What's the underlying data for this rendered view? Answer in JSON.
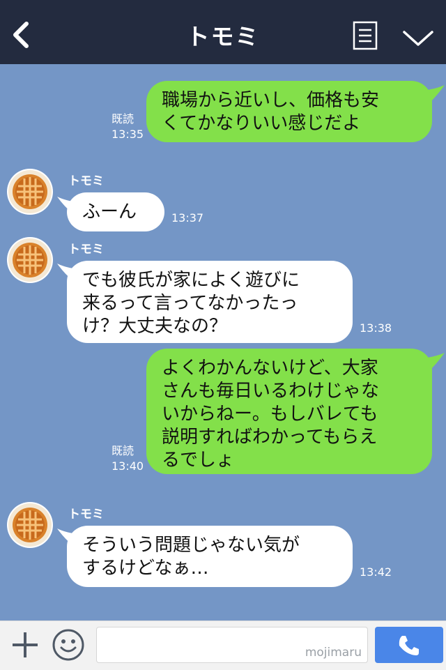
{
  "header": {
    "title": "トモミ",
    "icons": [
      "back-chevron",
      "note-list",
      "chevron-down"
    ]
  },
  "messages": [
    {
      "side": "me",
      "text": "職場から近いし、価格も安くてかなりいい感じだよ",
      "lines": [
        "職場から近いし、価格も安",
        "くてかなりいい感じだよ"
      ],
      "read": "既読",
      "time": "13:35"
    },
    {
      "side": "them",
      "sender": "トモミ",
      "lines": [
        "ふーん"
      ],
      "time": "13:37"
    },
    {
      "side": "them",
      "sender": "トモミ",
      "lines": [
        "でも彼氏が家によく遊びに",
        "来るって言ってなかったっ",
        "け？大丈夫なの？"
      ],
      "time": "13:38"
    },
    {
      "side": "me",
      "lines": [
        "よくわかんないけど、大家",
        "さんも毎日いるわけじゃな",
        "いからねー。もしバレても",
        "説明すればわかってもらえ",
        "るでしょ"
      ],
      "read": "既読",
      "time": "13:40"
    },
    {
      "side": "them",
      "sender": "トモミ",
      "lines": [
        "そういう問題じゃない気が",
        "するけどなぁ…"
      ],
      "time": "13:42"
    }
  ],
  "footer": {
    "input_placeholder": "",
    "watermark": "mojimaru",
    "icons": [
      "plus-icon",
      "smiley-icon",
      "phone-icon"
    ]
  },
  "colors": {
    "header": "#232b3f",
    "background": "#7496c6",
    "my_bubble": "#83e04a",
    "their_bubble": "#ffffff",
    "send_button": "#4a86e8"
  }
}
